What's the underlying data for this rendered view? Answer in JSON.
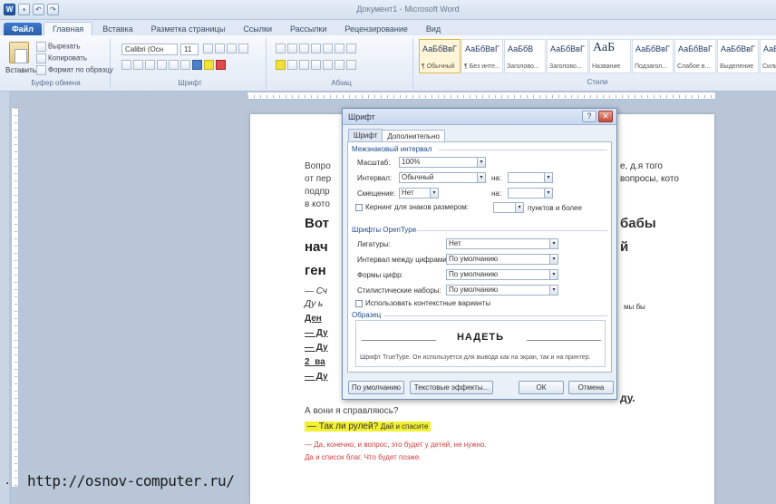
{
  "title": "Документ1 - Microsoft Word",
  "qat": {
    "app_icon": "W",
    "undo": "↶",
    "redo": "↷"
  },
  "tabs": [
    "Файл",
    "Главная",
    "Вставка",
    "Разметка страницы",
    "Ссылки",
    "Рассылки",
    "Рецензирование",
    "Вид"
  ],
  "ribbon": {
    "paste_label": "Вставить",
    "clipboard_cmds": [
      "Вырезать",
      "Копировать",
      "Формат по образцу"
    ],
    "clipboard_group": "Буфер обмена",
    "font_name": "Calibri (Осн",
    "font_size": "11",
    "font_group": "Шрифт",
    "paragraph_group": "Абзац",
    "styles_group": "Стили",
    "styles": [
      {
        "sample": "АаБбВвГ",
        "name": "¶ Обычный",
        "big": false
      },
      {
        "sample": "АаБбВвГ",
        "name": "¶ Без инте...",
        "big": false
      },
      {
        "sample": "АаБбВ",
        "name": "Заголово...",
        "big": false
      },
      {
        "sample": "АаБбВвГ",
        "name": "Заголово...",
        "big": false
      },
      {
        "sample": "АаБ",
        "name": "Название",
        "big": true
      },
      {
        "sample": "АаБбВвГ",
        "name": "Подзагол...",
        "big": false
      },
      {
        "sample": "АаБбВвГ",
        "name": "Слабое в...",
        "big": false
      },
      {
        "sample": "АаБбВвГ",
        "name": "Выделение",
        "big": false
      },
      {
        "sample": "АаБбВ",
        "name": "Сильное...",
        "big": false
      }
    ]
  },
  "document": {
    "lines": [
      "Вопро",
      "от пер",
      "подпр",
      "в кото"
    ],
    "right_frags": [
      "е, д.я того",
      "вопросы, кото"
    ],
    "bold_lines": [
      "Вот",
      "нач",
      "ген"
    ],
    "bold_right": [
      "бабы",
      "й"
    ],
    "sub_lines": [
      "— Сч",
      "Ду ь"
    ],
    "dial_lines": [
      "Ден",
      "— Ду",
      "— Ду",
      "2_ва",
      "— Ду"
    ],
    "tail": "ду.",
    "right_note": "мы бы",
    "line_a": "А  вони  я  справляюсь?",
    "yellow_main": "— Так ли рулей?",
    "yellow_small": "Дай и спасите",
    "red_line_1": "— Да, конечно, и вопрос, это будет у детей, не нужно.",
    "red_line_2": "Да и список благ. Что будет позже."
  },
  "dialog": {
    "title": "Шрифт",
    "help": "?",
    "close": "✕",
    "tabs": [
      "Шрифт",
      "Дополнительно"
    ],
    "section_spacing": "Межзнаковый интервал",
    "scale_label": "Масштаб:",
    "scale_value": "100%",
    "spacing_label": "Интервал:",
    "spacing_value": "Обычный",
    "spacing_on": "на:",
    "position_label": "Смещение:",
    "position_value": "Нет",
    "position_on": "на:",
    "kerning_label": "Кернинг для знаков размером:",
    "kerning_unit": "пунктов и более",
    "section_opentype": "Шрифты OpenType",
    "ligatures_label": "Лигатуры:",
    "ligatures_value": "Нет",
    "numspacing_label": "Интервал между цифрами:",
    "numspacing_value": "По умолчанию",
    "numforms_label": "Формы цифр:",
    "numforms_value": "По умолчанию",
    "stylistic_label": "Стилистические наборы:",
    "stylistic_value": "По умолчанию",
    "contextual_label": "Использовать контекстные варианты",
    "section_preview": "Образец",
    "preview_word": "НАДЕТЬ",
    "preview_desc": "Шрифт TrueType. Он используется для вывода как на экран, так и на принтер.",
    "btn_default": "По умолчанию",
    "btn_effects": "Текстовые эффекты...",
    "btn_ok": "ОК",
    "btn_cancel": "Отмена",
    "arrow": "▾"
  },
  "overlay": {
    "dot": ".",
    "url": "http://osnov-computer.ru/"
  }
}
